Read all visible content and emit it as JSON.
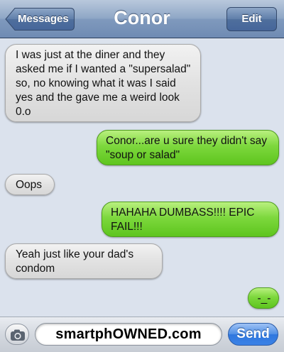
{
  "header": {
    "title": "Conor",
    "back_label": "Messages",
    "edit_label": "Edit"
  },
  "messages": [
    {
      "sender": "them",
      "text": "I was just at the diner and they asked me if I wanted a \"supersalad\" so, no knowing what it was I said yes and the gave me a weird look 0.o"
    },
    {
      "sender": "me",
      "text": "Conor...are u sure they didn't say \"soup or salad\""
    },
    {
      "sender": "them",
      "text": "Oops"
    },
    {
      "sender": "me",
      "text": "HAHAHA DUMBASS!!!! EPIC FAIL!!!"
    },
    {
      "sender": "them",
      "text": "Yeah just like your dad's condom"
    },
    {
      "sender": "me",
      "text": "-_-"
    }
  ],
  "composer": {
    "input_value": "smartphOWNED.com",
    "send_label": "Send",
    "camera_icon": "camera-icon"
  },
  "colors": {
    "nav_bar": "#7f99bd",
    "background": "#dbe2ed",
    "incoming_bubble": "#e2e2e2",
    "outgoing_bubble": "#7dd83d",
    "send_button": "#3b82e6"
  }
}
